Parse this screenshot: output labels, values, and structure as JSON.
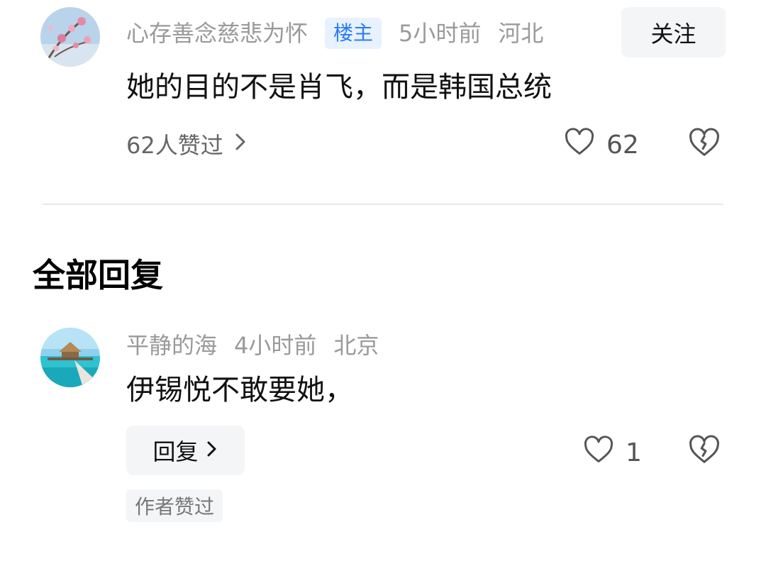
{
  "comment": {
    "username": "心存善念慈悲为怀",
    "badge": "楼主",
    "time": "5小时前",
    "location": "河北",
    "follow_label": "关注",
    "text": "她的目的不是肖飞，而是韩国总统",
    "likers_text": "62人赞过",
    "like_count": "62"
  },
  "section": {
    "title": "全部回复"
  },
  "reply": {
    "username": "平静的海",
    "time": "4小时前",
    "location": "北京",
    "text": "伊锡悦不敢要她，",
    "reply_label": "回复",
    "like_count": "1",
    "author_tag": "作者赞过"
  },
  "icons": {
    "like": "heart-outline-icon",
    "dislike": "broken-heart-icon",
    "chevron": "chevron-right-icon"
  },
  "colors": {
    "badge_text": "#2a7bf6",
    "badge_bg": "#e7f1ff",
    "meta_gray": "#9a9a9a"
  }
}
